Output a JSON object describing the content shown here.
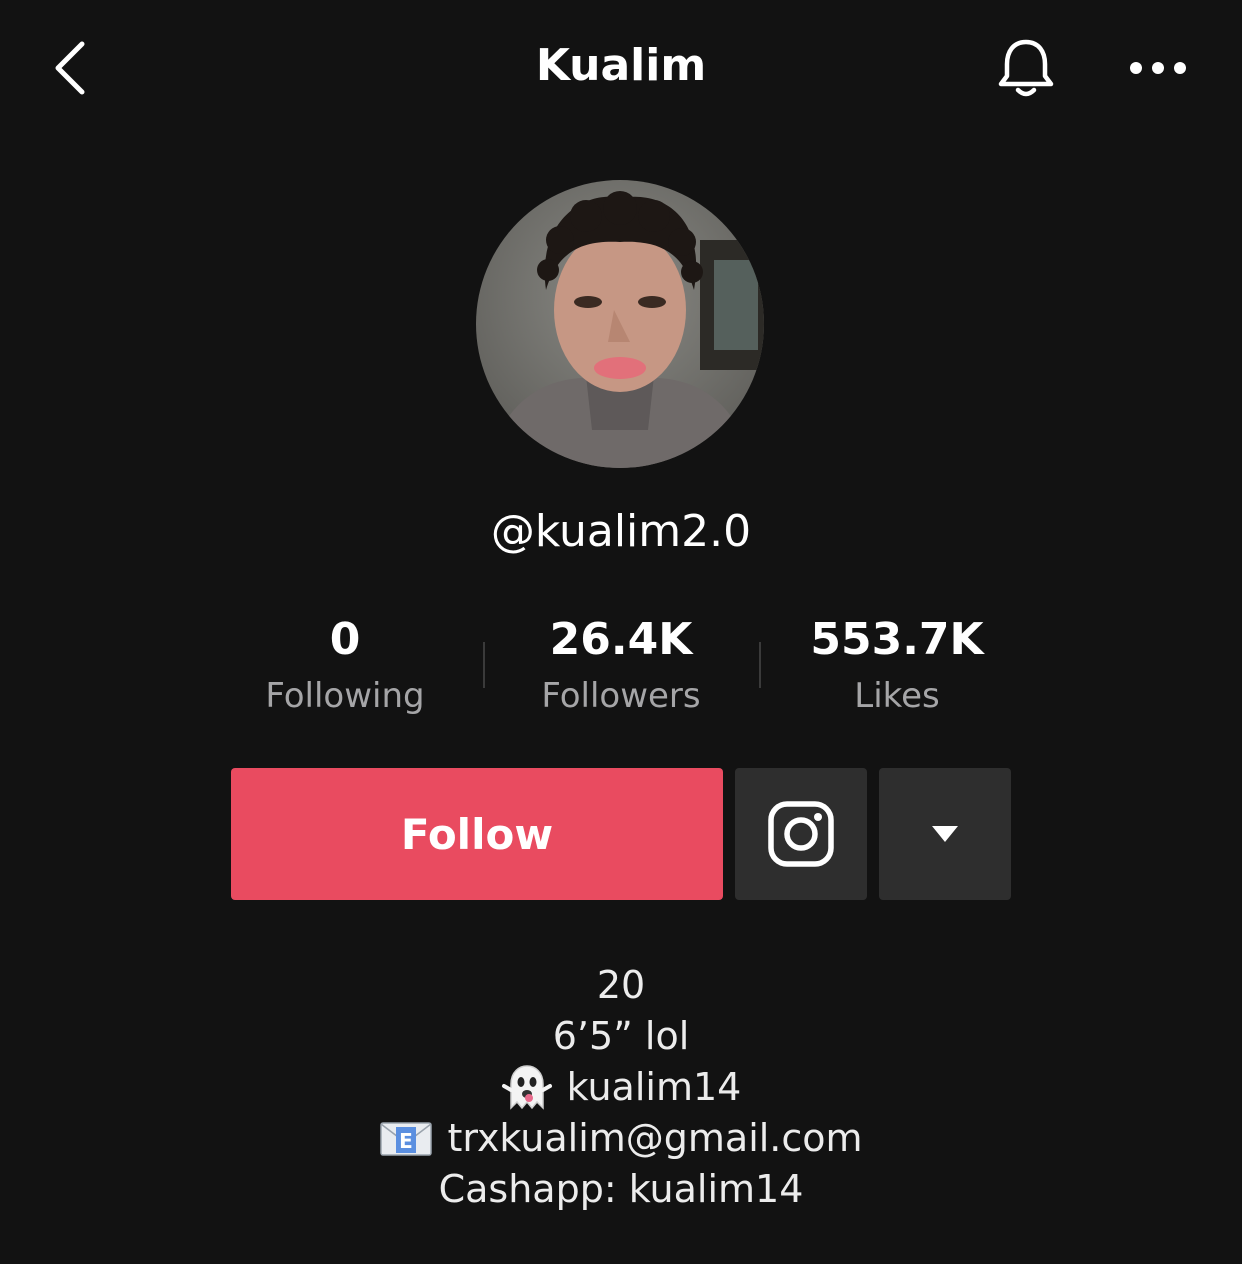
{
  "header": {
    "title": "Kualim"
  },
  "profile": {
    "username": "@kualim2.0"
  },
  "stats": [
    {
      "count": "0",
      "label": "Following"
    },
    {
      "count": "26.4K",
      "label": "Followers"
    },
    {
      "count": "553.7K",
      "label": "Likes"
    }
  ],
  "actions": {
    "follow_label": "Follow"
  },
  "bio": {
    "age": "20",
    "height": "6’5” lol",
    "snapchat": "kualim14",
    "email": "trxkualim@gmail.com",
    "cashapp": "Cashapp: kualim14"
  },
  "colors": {
    "background": "#121212",
    "follow_button": "#e94b60",
    "secondary_button": "#2e2e2e",
    "muted_text": "#a5a5a7"
  },
  "icons": [
    "back-arrow-icon",
    "bell-icon",
    "more-dots-icon",
    "instagram-icon",
    "caret-down-icon",
    "ghost-emoji-icon",
    "envelope-emoji-icon"
  ]
}
